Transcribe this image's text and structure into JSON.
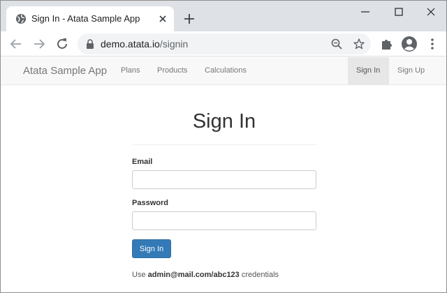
{
  "browser": {
    "tab_title": "Sign In - Atata Sample App",
    "url_host": "demo.atata.io",
    "url_path": "/signin"
  },
  "icons": {
    "favicon": "globe-icon",
    "tab_close": "close-icon",
    "new_tab": "plus-icon",
    "minimize": "minimize-icon",
    "maximize": "maximize-icon",
    "close_window": "close-icon",
    "back": "arrow-left-icon",
    "forward": "arrow-right-icon",
    "reload": "reload-icon",
    "lock": "lock-icon",
    "zoom": "magnifier-minus-icon",
    "bookmark": "star-icon",
    "extensions": "puzzle-icon",
    "profile": "account-circle-icon",
    "menu": "kebab-menu-icon"
  },
  "navbar": {
    "brand": "Atata Sample App",
    "links": [
      "Plans",
      "Products",
      "Calculations"
    ],
    "sign_in": "Sign In",
    "sign_up": "Sign Up"
  },
  "form": {
    "title": "Sign In",
    "email_label": "Email",
    "email_value": "",
    "password_label": "Password",
    "password_value": "",
    "submit_label": "Sign In",
    "hint_prefix": "Use",
    "hint_credentials": "admin@mail.com/abc123",
    "hint_suffix": "credentials"
  },
  "colors": {
    "primary": "#337ab7",
    "tabstrip": "#dee1e6",
    "navbar": "#f8f8f8"
  }
}
